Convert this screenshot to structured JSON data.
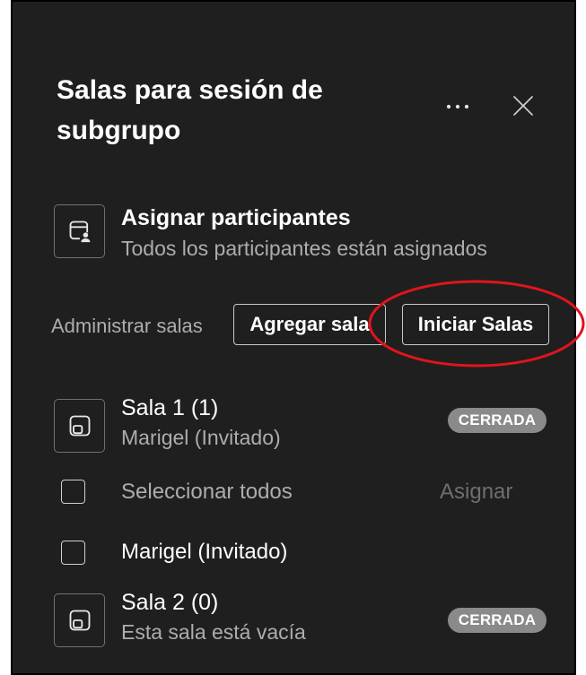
{
  "panel": {
    "title": "Salas para sesión de subgrupo",
    "more_icon": "more-icon",
    "close_icon": "close-icon"
  },
  "assign": {
    "icon": "assign-participants-icon",
    "title": "Asignar participantes",
    "subtitle": "Todos los participantes están asignados"
  },
  "manage": {
    "label": "Administrar salas",
    "add_room": "Agregar sala",
    "start_rooms": "Iniciar Salas"
  },
  "rooms": [
    {
      "icon": "room-icon",
      "name": "Sala 1 (1)",
      "subtitle": "Marigel (Invitado)",
      "status": "CERRADA",
      "select_all": {
        "label": "Seleccionar todos",
        "checked": false
      },
      "assign_action": {
        "label": "Asignar",
        "enabled": false
      },
      "participants": [
        {
          "name": "Marigel (Invitado)",
          "checked": false
        }
      ]
    },
    {
      "icon": "room-icon",
      "name": "Sala 2 (0)",
      "subtitle": "Esta sala está vacía",
      "status": "CERRADA"
    }
  ],
  "colors": {
    "page_bg": "#ffffff",
    "panel_bg": "#1f1f1f",
    "text_primary": "#ffffff",
    "text_secondary": "#adadad",
    "text_disabled": "#6e6e6e",
    "badge_bg": "#8a8a8a",
    "badge_text": "#ffffff",
    "annotation": "#e0141e"
  }
}
